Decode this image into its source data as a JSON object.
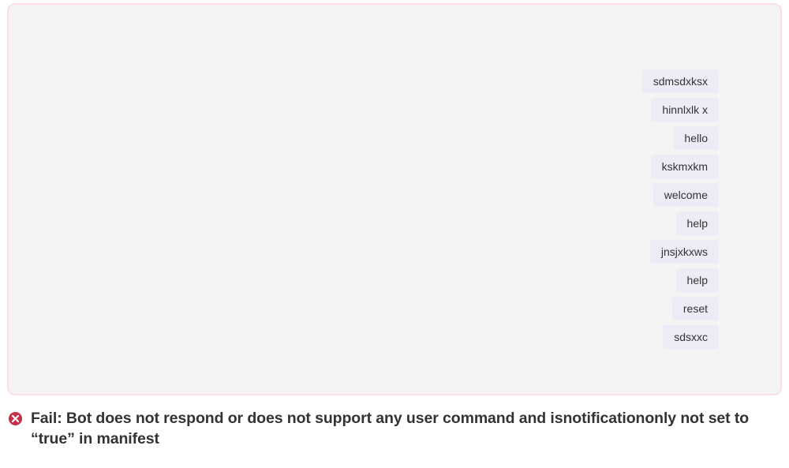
{
  "messages": [
    "sdmsdxksx",
    "hinnlxlk x",
    "hello",
    "kskmxkm",
    "welcome",
    "help",
    "jnsjxkxws",
    "help",
    "reset",
    "sdsxxc"
  ],
  "error": {
    "label_prefix": "Fail: ",
    "text": "Bot does not respond or does not support any user command and isnotificationonly not set to “true” in manifest"
  },
  "colors": {
    "panel_bg": "#f4f4f4",
    "panel_border": "#fbe1e1",
    "bubble_bg": "#ebecf6",
    "error_icon": "#c4314b"
  }
}
